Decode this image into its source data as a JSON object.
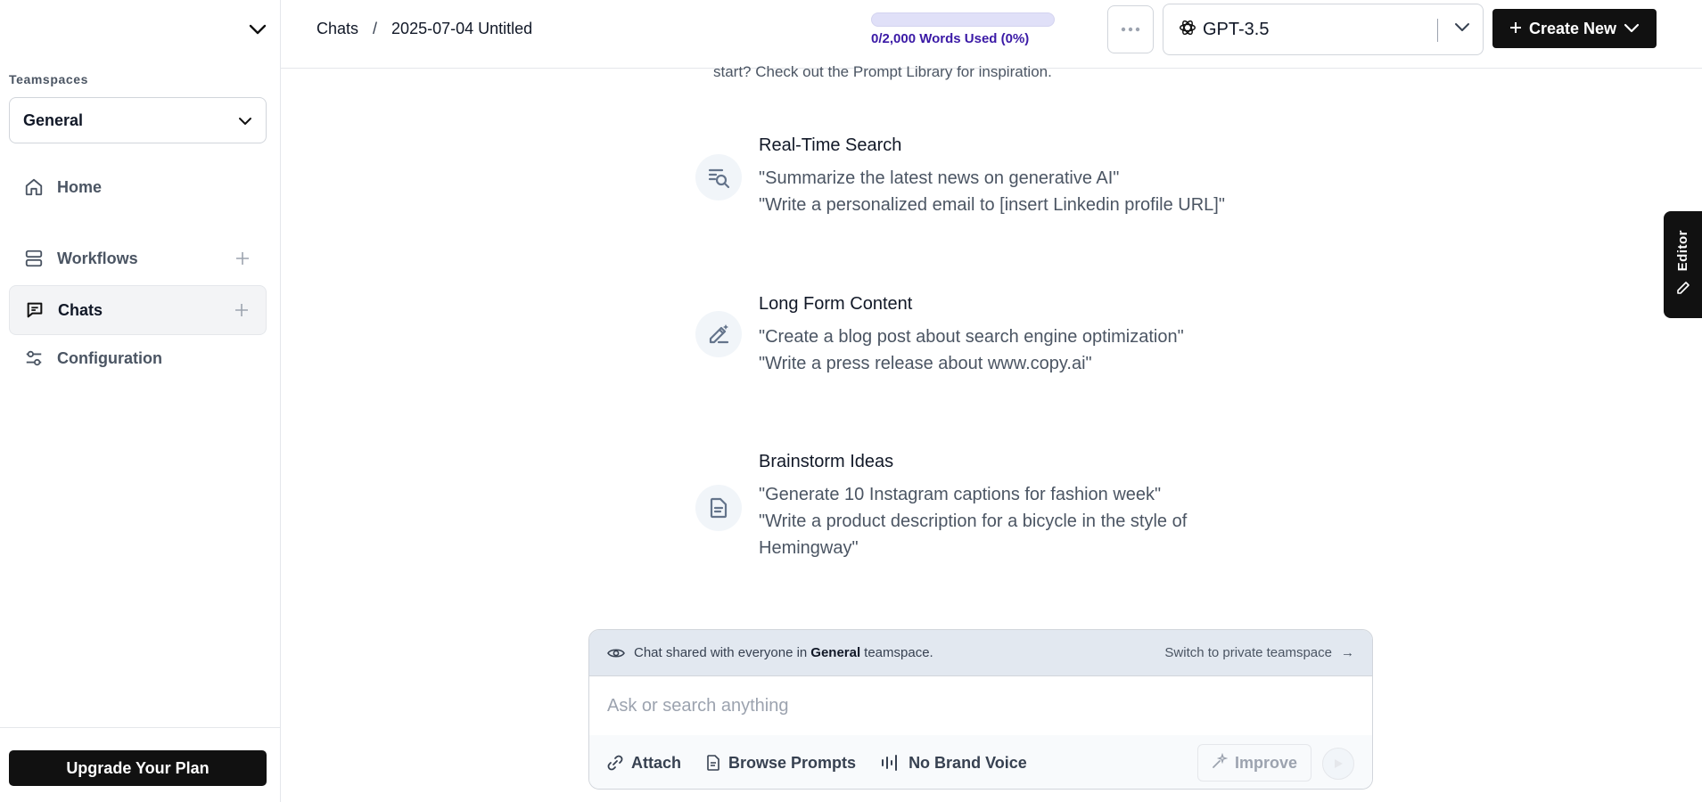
{
  "sidebar": {
    "teamspaces_label": "Teamspaces",
    "teamspace_selected": "General",
    "nav": [
      {
        "label": "Home",
        "icon": "home-icon"
      },
      {
        "label": "Workflows",
        "icon": "workflows-icon"
      },
      {
        "label": "Chats",
        "icon": "chat-icon",
        "active": true
      },
      {
        "label": "Configuration",
        "icon": "sliders-icon"
      }
    ],
    "upgrade_label": "Upgrade Your Plan"
  },
  "header": {
    "breadcrumb": [
      "Chats",
      "/",
      "2025-07-04 Untitled"
    ],
    "usage": {
      "text": "0/2,000 Words Used (0%)",
      "fraction": 0.0
    },
    "model": "GPT-3.5",
    "create_label": "Create New"
  },
  "main": {
    "intro_fragment": "start? Check out the Prompt Library for inspiration.",
    "suggestions": [
      {
        "icon": "search-list-icon",
        "title": "Real-Time Search",
        "lines": [
          "\"Summarize the latest news on generative AI\"",
          "\"Write a personalized email to [insert Linkedin profile URL]\""
        ]
      },
      {
        "icon": "magic-pen-icon",
        "title": "Long Form Content",
        "lines": [
          "\"Create a blog post about search engine optimization\"",
          "\"Write a press release about www.copy.ai\""
        ]
      },
      {
        "icon": "document-icon",
        "title": "Brainstorm Ideas",
        "lines": [
          "\"Generate 10 Instagram captions for fashion week\"",
          "\"Write a product description for a bicycle in the style of Hemingway\""
        ]
      }
    ]
  },
  "editor_tab": {
    "label": "Editor"
  },
  "chat": {
    "share_text_before": "Chat shared with everyone in",
    "share_team": "General",
    "share_text_after": "teamspace.",
    "switch_label": "Switch to private teamspace",
    "switch_arrow": "→",
    "input_placeholder": "Ask or search anything",
    "tools": {
      "attach": "Attach",
      "browse": "Browse Prompts",
      "voice": "No Brand Voice"
    },
    "improve_label": "Improve"
  },
  "colors": {
    "primary_dark": "#111111",
    "usage_text": "#3b1aa6",
    "usage_track": "#e0e0f8"
  }
}
